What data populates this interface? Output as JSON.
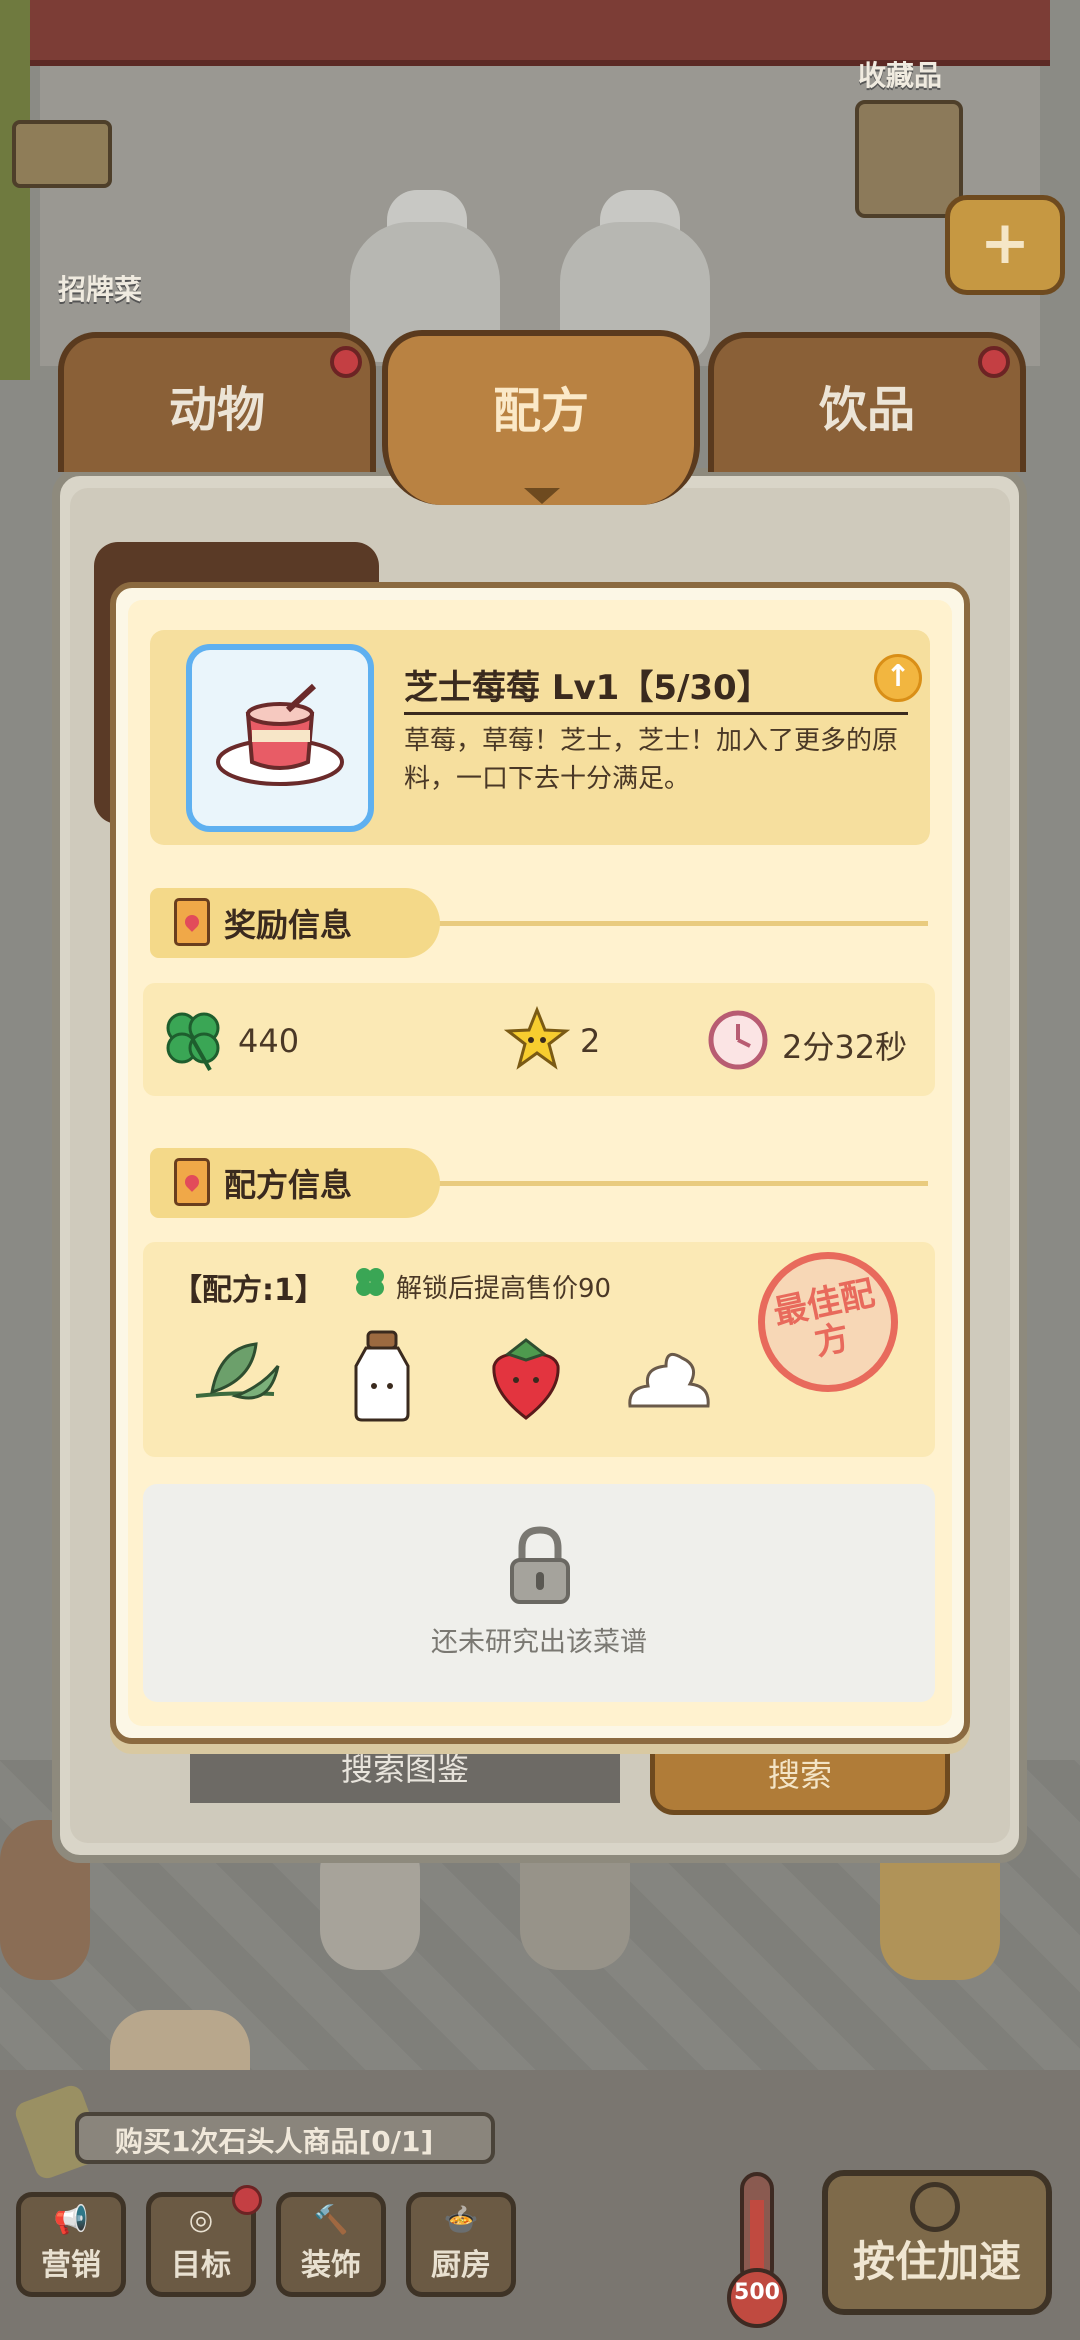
{
  "background": {
    "collection_label": "收藏品",
    "signature_dish_label": "招牌菜",
    "quest_text": "购买1次石头人商品[0/1]",
    "bottom_buttons": [
      {
        "label": "营销",
        "icon": "megaphone-icon"
      },
      {
        "label": "目标",
        "icon": "target-icon"
      },
      {
        "label": "装饰",
        "icon": "hammer-icon"
      },
      {
        "label": "厨房",
        "icon": "pot-icon"
      }
    ],
    "thermometer_value": "500",
    "speed_button_label": "按住加速",
    "hidden_left_button": "搜索图鉴",
    "hidden_right_button": "搜索"
  },
  "tabs": [
    {
      "label": "动物",
      "active": false,
      "badge": true
    },
    {
      "label": "配方",
      "active": true,
      "badge": false
    },
    {
      "label": "饮品",
      "active": false,
      "badge": true
    }
  ],
  "modal": {
    "dish": {
      "name": "芝士莓莓 Lv1【5/30】",
      "description": "草莓，草莓！芝士，芝士！加入了更多的原料，一口下去十分满足。"
    },
    "reward_section": {
      "title": "奖励信息",
      "clover": "440",
      "stars": "2",
      "time": "2分32秒"
    },
    "recipe_section": {
      "title": "配方信息",
      "recipe_label": "【配方:1】",
      "unlock_note": "解锁后提高售价90",
      "stamp_text": "最佳配方",
      "ingredients": [
        "tea-leaf-icon",
        "milk-bottle-icon",
        "strawberry-icon",
        "cream-icon"
      ]
    },
    "locked_text": "还未研究出该菜谱"
  },
  "colors": {
    "accent": "#b98242",
    "panel": "#fff2cf",
    "header_card": "#f6df9e",
    "stamp": "#e86a5c"
  }
}
